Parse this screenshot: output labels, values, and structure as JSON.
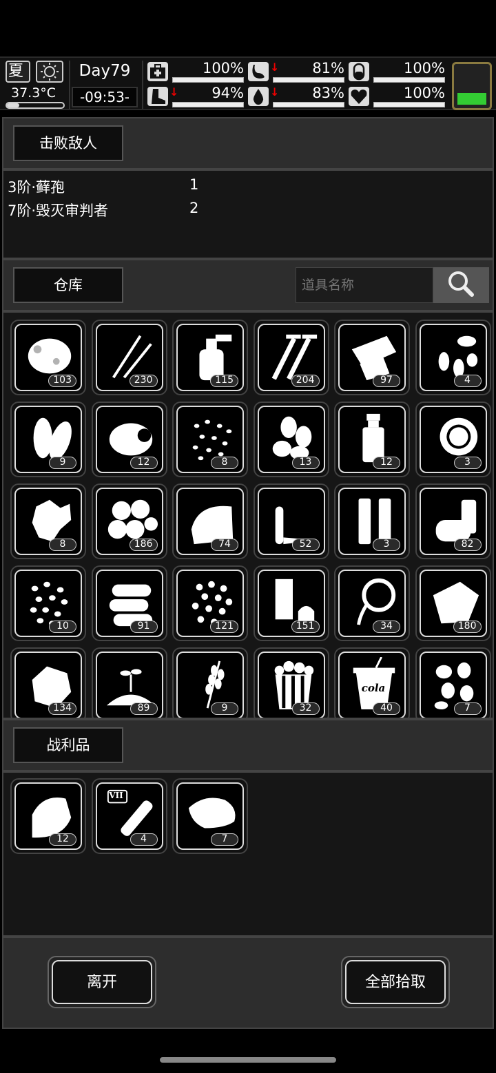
{
  "status": {
    "season": "夏",
    "temperature": "37.3°C",
    "day": "Day79",
    "clock": "-09:53-",
    "stats": [
      {
        "name": "health",
        "value": "100%",
        "arrow": ""
      },
      {
        "name": "stomach",
        "value": "81%",
        "arrow": "↓"
      },
      {
        "name": "pill",
        "value": "100%",
        "arrow": ""
      },
      {
        "name": "stamina",
        "value": "94%",
        "arrow": "↓"
      },
      {
        "name": "water",
        "value": "83%",
        "arrow": "↓"
      },
      {
        "name": "mood",
        "value": "100%",
        "arrow": ""
      }
    ],
    "battery_level": 0.3
  },
  "enemies": {
    "tab_label": "击败敌人",
    "list": [
      {
        "name": "3阶·藓孢",
        "count": "1"
      },
      {
        "name": "7阶·毁灭审判者",
        "count": "2"
      }
    ]
  },
  "storage": {
    "tab_label": "仓库",
    "search_placeholder": "道具名称",
    "items": [
      {
        "icon": "moss-icon",
        "count": "103"
      },
      {
        "icon": "needles-icon",
        "count": "230"
      },
      {
        "icon": "spray-bottle-icon",
        "count": "115"
      },
      {
        "icon": "screws-icon",
        "count": "204"
      },
      {
        "icon": "paper-icon",
        "count": "97"
      },
      {
        "icon": "seeds-icon",
        "count": "4"
      },
      {
        "icon": "leaves-icon",
        "count": "9"
      },
      {
        "icon": "meat-icon",
        "count": "12"
      },
      {
        "icon": "grains-icon",
        "count": "8"
      },
      {
        "icon": "almonds-icon",
        "count": "13"
      },
      {
        "icon": "bottle-icon",
        "count": "12"
      },
      {
        "icon": "lemon-icon",
        "count": "3"
      },
      {
        "icon": "ginger-icon",
        "count": "8"
      },
      {
        "icon": "chestnuts-icon",
        "count": "186"
      },
      {
        "icon": "cloth-icon",
        "count": "74"
      },
      {
        "icon": "bullet-icon",
        "count": "52"
      },
      {
        "icon": "tubes-icon",
        "count": "3"
      },
      {
        "icon": "cans-icon",
        "count": "82"
      },
      {
        "icon": "beans-icon",
        "count": "10"
      },
      {
        "icon": "logs-icon",
        "count": "91"
      },
      {
        "icon": "peas-icon",
        "count": "121"
      },
      {
        "icon": "tape-icon",
        "count": "151"
      },
      {
        "icon": "rope-icon",
        "count": "34"
      },
      {
        "icon": "fabric-icon",
        "count": "180"
      },
      {
        "icon": "rock-icon",
        "count": "134"
      },
      {
        "icon": "soil-sprout-icon",
        "count": "89"
      },
      {
        "icon": "wheat-icon",
        "count": "9"
      },
      {
        "icon": "popcorn-icon",
        "count": "32"
      },
      {
        "icon": "cola-cup-icon",
        "count": "40",
        "text": "cola"
      },
      {
        "icon": "pine-nuts-icon",
        "count": "7"
      }
    ]
  },
  "loot": {
    "tab_label": "战利品",
    "items": [
      {
        "icon": "folded-cloth-icon",
        "count": "12"
      },
      {
        "icon": "test-tube-icon",
        "count": "4",
        "text": "VII"
      },
      {
        "icon": "sweet-potato-icon",
        "count": "7"
      }
    ]
  },
  "actions": {
    "leave": "离开",
    "take_all": "全部拾取"
  }
}
